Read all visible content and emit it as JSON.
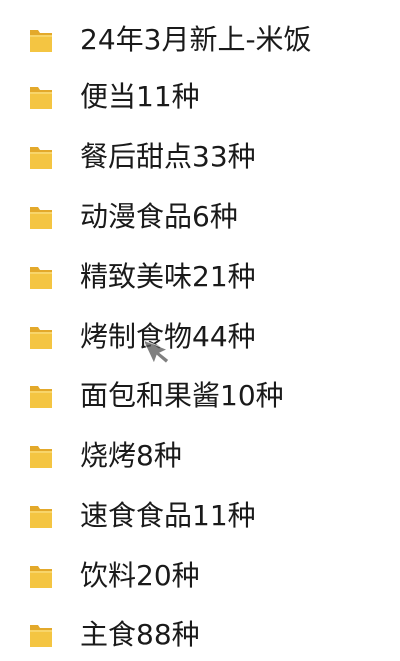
{
  "folders": [
    {
      "label": "24年3月新上-米饭",
      "icon": "folder-icon"
    },
    {
      "label": "便当11种",
      "icon": "folder-icon"
    },
    {
      "label": "餐后甜点33种",
      "icon": "folder-icon"
    },
    {
      "label": "动漫食品6种",
      "icon": "folder-icon"
    },
    {
      "label": "精致美味21种",
      "icon": "folder-icon"
    },
    {
      "label": "烤制食物44种",
      "icon": "folder-icon"
    },
    {
      "label": "面包和果酱10种",
      "icon": "folder-icon"
    },
    {
      "label": "烧烤8种",
      "icon": "folder-icon"
    },
    {
      "label": "速食食品11种",
      "icon": "folder-icon"
    },
    {
      "label": "饮料20种",
      "icon": "folder-icon"
    },
    {
      "label": "主食88种",
      "icon": "folder-icon"
    }
  ],
  "colors": {
    "folder_front": "#f4c542",
    "folder_back": "#e3a92b",
    "text": "#1a1a1a",
    "background": "#ffffff"
  },
  "cursor_icon": "pointer-cursor-icon"
}
